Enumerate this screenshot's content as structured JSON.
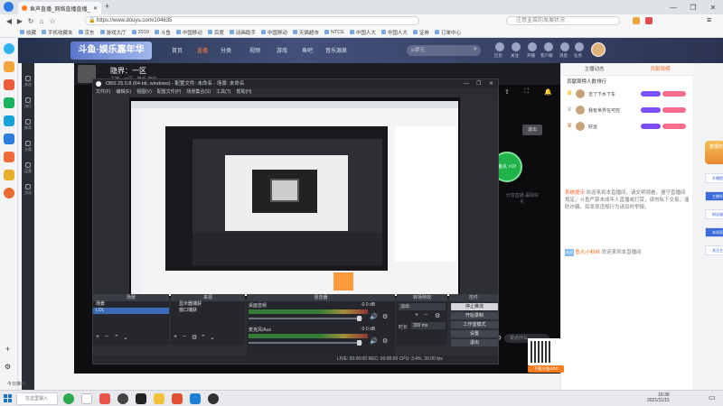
{
  "browser": {
    "tab_title": "鱼声直播_网络直播直播_斗鱼直播",
    "url": "https://www.douyu.com/104635",
    "search_placeholder": "注意韭菜的发展状况",
    "window_controls": [
      "—",
      "❐",
      "✕"
    ],
    "bookmarks": [
      "收藏",
      "手机收藏夹",
      "京东",
      "游戏大厅",
      "2019",
      "斗鱼",
      "中国移动",
      "百度",
      "动画助手",
      "中国移动",
      "天猫超市",
      "NTCE",
      "中国人大",
      "中国人大",
      "证券",
      "订单中心"
    ]
  },
  "site_header": {
    "logo": "斗鱼·娱乐嘉年华",
    "nav": [
      "首页",
      "直播",
      "分类",
      "视频",
      "游戏",
      "鱼吧",
      "音乐源泉"
    ],
    "active_nav": "直播",
    "search_placeholder": "w梦元",
    "icons": [
      "历史",
      "关注",
      "开播",
      "客户端",
      "消息",
      "任务"
    ]
  },
  "left_sidebar": [
    "关注",
    "排行",
    "推荐",
    "分类",
    "运营",
    "活动"
  ],
  "room": {
    "title": "隐界：一区",
    "subtitle": "主播：一区 · 娱乐·游戏",
    "exit_label": "退出",
    "donate_label": "鱼丸 ×10",
    "share_text": "分享直播 赢取好礼",
    "danmaku_placeholder": "说点什么"
  },
  "obs": {
    "title": "OBS 25.0.8 (64-bit, windows) - 配置文件: 未命名 - 场景: 未命名",
    "menu": [
      "文件(F)",
      "编辑(E)",
      "视图(V)",
      "配置文件(P)",
      "场景集合(S)",
      "工具(T)",
      "帮助(H)"
    ],
    "panels": [
      "场景",
      "来源",
      "混音器",
      "转场特效",
      "控件"
    ],
    "scenes": [
      "场景",
      "LOL"
    ],
    "sources": [
      "显示器捕获",
      "窗口捕获"
    ],
    "mixer": [
      {
        "name": "桌面音频",
        "level_db": "-0.0 dB"
      },
      {
        "name": "麦克风/Aux",
        "level_db": "-0.0 dB"
      }
    ],
    "transition": {
      "name": "淡出",
      "duration_label": "时长",
      "duration": "300 ms"
    },
    "controls": [
      "停止推流",
      "开始录制",
      "工作室模式",
      "设置",
      "退出"
    ],
    "status": "LIVE: 00:00:00    REC: 00:00:00    CPU: 3.4%, 30.00 fps"
  },
  "chat": {
    "tabs": [
      "主播动态",
      "贡献周榜",
      "贡献周榜"
    ],
    "gift_rank_title": "贡献周榜人数排行",
    "ranks": [
      "吉了下水下车",
      "我有世界在可控",
      "好运"
    ],
    "announcement_label": "系统提示",
    "announcement": "欢迎来到本直播间，请文明观看，遵守直播间规定。斗鱼严禁未成年人直播或打赏，请勿私下交易，谨防诈骗。如发现违规行为请及时举报。",
    "welcome_label": "欢迎",
    "welcome_user": "鱼丸小粉丝",
    "welcome_text": "欢迎来到本直播间",
    "qr_caption": "下载斗鱼APP"
  },
  "right_float": {
    "top": "直播日历",
    "cards": [
      "开播提醒",
      "主播任务",
      "粉丝福利",
      "本场直播",
      "关注主播"
    ]
  },
  "taskbar": {
    "search_label": "在这里输入",
    "notify_label": "今日推荐",
    "time": "16:38",
    "date": "2021/11/15"
  },
  "colors": {
    "accent": "#ff6d1f",
    "obs_bg": "#2d2f35",
    "header_bg": "#2d3452"
  }
}
